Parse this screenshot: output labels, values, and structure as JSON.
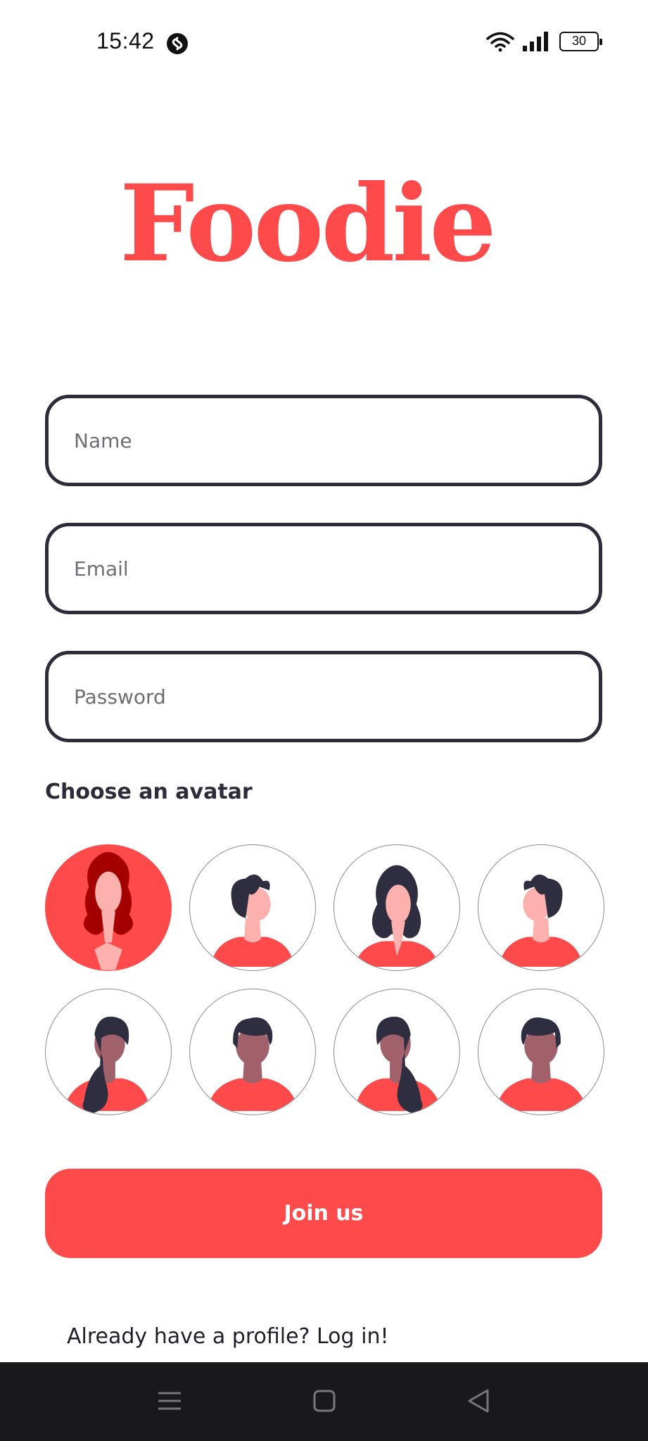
{
  "status_bar": {
    "time": "15:42",
    "app_icon": "shazam-icon",
    "wifi_icon": "wifi-icon",
    "signal_icon": "signal-icon",
    "battery_level": "30"
  },
  "logo": {
    "text": "Foodie",
    "color": "#fe4a4a"
  },
  "form": {
    "name_placeholder": "Name",
    "name_value": "",
    "email_placeholder": "Email",
    "email_value": "",
    "password_placeholder": "Password",
    "password_value": ""
  },
  "avatars": {
    "heading": "Choose an avatar",
    "selected_index": 0,
    "items": [
      "woman-light-long-hair",
      "man-light-short-hair",
      "woman-light-long-hair",
      "man-light-short-hair",
      "woman-dark-ponytail",
      "man-dark-short-hair",
      "woman-dark-ponytail",
      "man-dark-short-hair"
    ]
  },
  "join_button": {
    "label": "Join us"
  },
  "login_link": {
    "label": "Already have a profile? Log in!"
  },
  "nav_bar": {
    "menu_icon": "menu-icon",
    "home_icon": "home-square-icon",
    "back_icon": "back-triangle-icon"
  },
  "colors": {
    "accent": "#fe4a4a",
    "text": "#2e2c3b",
    "skin_light": "#fcb1ae",
    "skin_dark": "#a0616a",
    "hair": "#2f2e41"
  }
}
